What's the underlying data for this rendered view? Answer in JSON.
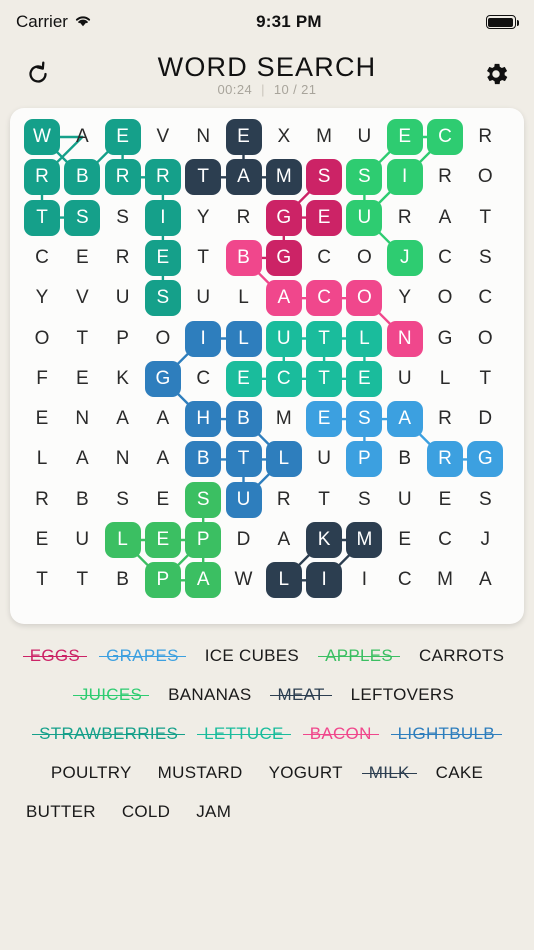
{
  "status_bar": {
    "carrier": "Carrier",
    "time": "9:31 PM",
    "wifi_icon": "wifi-icon",
    "battery_icon": "battery-full-icon"
  },
  "header": {
    "title": "WORD SEARCH",
    "timer": "00:24",
    "separator": "|",
    "progress": "10 / 21",
    "restart_icon": "restart-icon",
    "settings_icon": "gear-icon"
  },
  "grid": {
    "rows": 12,
    "cols": 12,
    "letters": [
      [
        "W",
        "A",
        "E",
        "V",
        "N",
        "E",
        "X",
        "M",
        "U",
        "E",
        "C",
        "R"
      ],
      [
        "R",
        "B",
        "R",
        "R",
        "T",
        "A",
        "M",
        "S",
        "S",
        "I",
        "R",
        "O"
      ],
      [
        "T",
        "S",
        "S",
        "I",
        "Y",
        "R",
        "G",
        "E",
        "U",
        "R",
        "A",
        "T"
      ],
      [
        "C",
        "E",
        "R",
        "E",
        "T",
        "B",
        "G",
        "C",
        "O",
        "J",
        "C",
        "S"
      ],
      [
        "Y",
        "V",
        "U",
        "S",
        "U",
        "L",
        "A",
        "C",
        "O",
        "Y",
        "O",
        "C"
      ],
      [
        "O",
        "T",
        "P",
        "O",
        "I",
        "L",
        "U",
        "T",
        "L",
        "N",
        "G",
        "O"
      ],
      [
        "F",
        "E",
        "K",
        "G",
        "C",
        "E",
        "C",
        "T",
        "E",
        "U",
        "L",
        "T"
      ],
      [
        "E",
        "N",
        "A",
        "A",
        "H",
        "B",
        "M",
        "E",
        "S",
        "A",
        "R",
        "D"
      ],
      [
        "L",
        "A",
        "N",
        "A",
        "B",
        "T",
        "L",
        "U",
        "P",
        "B",
        "R",
        "G"
      ],
      [
        "R",
        "B",
        "S",
        "E",
        "S",
        "U",
        "R",
        "T",
        "S",
        "U",
        "E",
        "S"
      ],
      [
        "E",
        "U",
        "L",
        "E",
        "P",
        "D",
        "A",
        "K",
        "M",
        "E",
        "C",
        "J"
      ],
      [
        "T",
        "T",
        "B",
        "P",
        "A",
        "W",
        "L",
        "I",
        "I",
        "C",
        "M",
        "A"
      ]
    ],
    "highlights": [
      {
        "word": "STRAWBERRIES",
        "color": "#15A08A",
        "path": [
          [
            0,
            0
          ],
          [
            1,
            1
          ],
          [
            0,
            2
          ],
          [
            1,
            3
          ],
          [
            2,
            0
          ],
          [
            1,
            2
          ],
          [
            1,
            0
          ],
          [
            2,
            1
          ],
          [
            3,
            3
          ],
          [
            4,
            3
          ],
          [
            2,
            3
          ]
        ]
      },
      {
        "word": "MEAT",
        "color": "#2C3E50",
        "path": [
          [
            0,
            5
          ],
          [
            1,
            5
          ],
          [
            1,
            4
          ],
          [
            1,
            6
          ]
        ]
      },
      {
        "word": "EGGS",
        "color": "#CC2366",
        "path": [
          [
            1,
            7
          ],
          [
            2,
            6
          ],
          [
            2,
            7
          ],
          [
            3,
            6
          ]
        ]
      },
      {
        "word": "JUICES",
        "color": "#2ECC71",
        "path": [
          [
            0,
            9
          ],
          [
            0,
            10
          ],
          [
            1,
            8
          ],
          [
            1,
            9
          ],
          [
            2,
            8
          ],
          [
            3,
            9
          ]
        ]
      },
      {
        "word": "BACON",
        "color": "#F0478C",
        "path": [
          [
            3,
            5
          ],
          [
            4,
            6
          ],
          [
            4,
            7
          ],
          [
            4,
            8
          ],
          [
            5,
            9
          ]
        ]
      },
      {
        "word": "LIGHTBULB",
        "color": "#2E7EBD",
        "path": [
          [
            5,
            4
          ],
          [
            5,
            5
          ],
          [
            6,
            3
          ],
          [
            7,
            4
          ],
          [
            7,
            5
          ],
          [
            8,
            5
          ],
          [
            8,
            6
          ],
          [
            8,
            4
          ],
          [
            9,
            5
          ]
        ]
      },
      {
        "word": "LETTUCE",
        "color": "#1ABC9C",
        "path": [
          [
            5,
            6
          ],
          [
            5,
            7
          ],
          [
            5,
            8
          ],
          [
            6,
            5
          ],
          [
            6,
            6
          ],
          [
            6,
            7
          ],
          [
            6,
            8
          ]
        ]
      },
      {
        "word": "GRAPES",
        "color": "#3CA0E0",
        "path": [
          [
            7,
            7
          ],
          [
            7,
            8
          ],
          [
            7,
            9
          ],
          [
            8,
            8
          ],
          [
            8,
            10
          ],
          [
            8,
            11
          ]
        ]
      },
      {
        "word": "APPLES",
        "color": "#3BBF62",
        "path": [
          [
            9,
            4
          ],
          [
            10,
            2
          ],
          [
            10,
            3
          ],
          [
            10,
            4
          ],
          [
            11,
            3
          ],
          [
            11,
            4
          ]
        ]
      },
      {
        "word": "MILK",
        "color": "#2C3E50",
        "path": [
          [
            10,
            7
          ],
          [
            10,
            8
          ],
          [
            11,
            6
          ],
          [
            11,
            7
          ]
        ]
      }
    ],
    "connections": [
      {
        "color": "#15A08A",
        "segs": [
          [
            [
              0,
              0
            ],
            [
              0,
              1
            ]
          ],
          [
            [
              0,
              1
            ],
            [
              1,
              0
            ]
          ],
          [
            [
              0,
              0
            ],
            [
              1,
              1
            ]
          ],
          [
            [
              1,
              0
            ],
            [
              2,
              0
            ]
          ],
          [
            [
              2,
              0
            ],
            [
              2,
              1
            ]
          ],
          [
            [
              1,
              1
            ],
            [
              0,
              2
            ]
          ],
          [
            [
              0,
              2
            ],
            [
              1,
              2
            ]
          ],
          [
            [
              1,
              2
            ],
            [
              1,
              3
            ]
          ],
          [
            [
              1,
              3
            ],
            [
              2,
              3
            ]
          ],
          [
            [
              2,
              3
            ],
            [
              3,
              3
            ]
          ],
          [
            [
              3,
              3
            ],
            [
              4,
              3
            ]
          ]
        ]
      },
      {
        "color": "#2C3E50",
        "segs": [
          [
            [
              0,
              5
            ],
            [
              1,
              5
            ]
          ],
          [
            [
              1,
              4
            ],
            [
              1,
              5
            ]
          ],
          [
            [
              1,
              5
            ],
            [
              1,
              6
            ]
          ]
        ]
      },
      {
        "color": "#CC2366",
        "segs": [
          [
            [
              1,
              7
            ],
            [
              2,
              6
            ]
          ],
          [
            [
              2,
              6
            ],
            [
              2,
              7
            ]
          ],
          [
            [
              2,
              6
            ],
            [
              3,
              6
            ]
          ],
          [
            [
              3,
              5
            ],
            [
              3,
              6
            ]
          ]
        ]
      },
      {
        "color": "#2ECC71",
        "segs": [
          [
            [
              0,
              9
            ],
            [
              0,
              10
            ]
          ],
          [
            [
              0,
              9
            ],
            [
              1,
              8
            ]
          ],
          [
            [
              0,
              10
            ],
            [
              1,
              9
            ]
          ],
          [
            [
              1,
              9
            ],
            [
              2,
              8
            ]
          ],
          [
            [
              1,
              8
            ],
            [
              2,
              8
            ]
          ],
          [
            [
              2,
              8
            ],
            [
              3,
              9
            ]
          ]
        ]
      },
      {
        "color": "#F0478C",
        "segs": [
          [
            [
              3,
              5
            ],
            [
              4,
              6
            ]
          ],
          [
            [
              4,
              6
            ],
            [
              4,
              7
            ]
          ],
          [
            [
              4,
              7
            ],
            [
              4,
              8
            ]
          ],
          [
            [
              4,
              8
            ],
            [
              5,
              9
            ]
          ]
        ]
      },
      {
        "color": "#2E7EBD",
        "segs": [
          [
            [
              5,
              4
            ],
            [
              5,
              5
            ]
          ],
          [
            [
              5,
              4
            ],
            [
              6,
              3
            ]
          ],
          [
            [
              6,
              3
            ],
            [
              7,
              4
            ]
          ],
          [
            [
              7,
              4
            ],
            [
              7,
              5
            ]
          ],
          [
            [
              7,
              5
            ],
            [
              8,
              6
            ]
          ],
          [
            [
              8,
              4
            ],
            [
              8,
              5
            ]
          ],
          [
            [
              8,
              5
            ],
            [
              8,
              6
            ]
          ],
          [
            [
              8,
              5
            ],
            [
              9,
              5
            ]
          ],
          [
            [
              8,
              6
            ],
            [
              9,
              5
            ]
          ]
        ]
      },
      {
        "color": "#1ABC9C",
        "segs": [
          [
            [
              5,
              6
            ],
            [
              5,
              7
            ]
          ],
          [
            [
              5,
              7
            ],
            [
              5,
              8
            ]
          ],
          [
            [
              5,
              6
            ],
            [
              6,
              6
            ]
          ],
          [
            [
              5,
              7
            ],
            [
              6,
              7
            ]
          ],
          [
            [
              5,
              8
            ],
            [
              6,
              8
            ]
          ],
          [
            [
              6,
              5
            ],
            [
              6,
              6
            ]
          ],
          [
            [
              6,
              6
            ],
            [
              6,
              7
            ]
          ],
          [
            [
              6,
              7
            ],
            [
              6,
              8
            ]
          ]
        ]
      },
      {
        "color": "#3CA0E0",
        "segs": [
          [
            [
              7,
              7
            ],
            [
              7,
              8
            ]
          ],
          [
            [
              7,
              8
            ],
            [
              8,
              8
            ]
          ],
          [
            [
              7,
              8
            ],
            [
              7,
              9
            ]
          ],
          [
            [
              7,
              9
            ],
            [
              8,
              10
            ]
          ],
          [
            [
              8,
              10
            ],
            [
              8,
              11
            ]
          ]
        ]
      },
      {
        "color": "#3BBF62",
        "segs": [
          [
            [
              9,
              4
            ],
            [
              10,
              4
            ]
          ],
          [
            [
              10,
              2
            ],
            [
              10,
              3
            ]
          ],
          [
            [
              10,
              3
            ],
            [
              10,
              4
            ]
          ],
          [
            [
              10,
              2
            ],
            [
              11,
              3
            ]
          ],
          [
            [
              11,
              3
            ],
            [
              10,
              4
            ]
          ],
          [
            [
              10,
              4
            ],
            [
              11,
              4
            ]
          ],
          [
            [
              11,
              3
            ],
            [
              11,
              4
            ]
          ]
        ]
      },
      {
        "color": "#2C3E50",
        "segs": [
          [
            [
              10,
              7
            ],
            [
              10,
              8
            ]
          ],
          [
            [
              11,
              6
            ],
            [
              10,
              7
            ]
          ],
          [
            [
              11,
              6
            ],
            [
              11,
              7
            ]
          ],
          [
            [
              11,
              7
            ],
            [
              10,
              8
            ]
          ]
        ]
      }
    ]
  },
  "word_list": {
    "rows": [
      [
        {
          "label": "EGGS",
          "found": true,
          "color": "#CC2366"
        },
        {
          "label": "GRAPES",
          "found": true,
          "color": "#3CA0E0"
        },
        {
          "label": "ICE CUBES",
          "found": false,
          "color": "#1A1A1A"
        },
        {
          "label": "APPLES",
          "found": true,
          "color": "#3BBF62"
        },
        {
          "label": "CARROTS",
          "found": false,
          "color": "#1A1A1A"
        }
      ],
      [
        {
          "label": "JUICES",
          "found": true,
          "color": "#2ECC71"
        },
        {
          "label": "BANANAS",
          "found": false,
          "color": "#1A1A1A"
        },
        {
          "label": "MEAT",
          "found": true,
          "color": "#2C3E50"
        },
        {
          "label": "LEFTOVERS",
          "found": false,
          "color": "#1A1A1A"
        }
      ],
      [
        {
          "label": "STRAWBERRIES",
          "found": true,
          "color": "#15A08A"
        },
        {
          "label": "LETTUCE",
          "found": true,
          "color": "#1ABC9C"
        },
        {
          "label": "BACON",
          "found": true,
          "color": "#F0478C"
        },
        {
          "label": "LIGHTBULB",
          "found": true,
          "color": "#2E7EBD"
        }
      ],
      [
        {
          "label": "POULTRY",
          "found": false,
          "color": "#1A1A1A"
        },
        {
          "label": "MUSTARD",
          "found": false,
          "color": "#1A1A1A"
        },
        {
          "label": "YOGURT",
          "found": false,
          "color": "#1A1A1A"
        },
        {
          "label": "MILK",
          "found": true,
          "color": "#2C3E50"
        },
        {
          "label": "CAKE",
          "found": false,
          "color": "#1A1A1A"
        }
      ],
      [
        {
          "label": "BUTTER",
          "found": false,
          "color": "#1A1A1A"
        },
        {
          "label": "COLD",
          "found": false,
          "color": "#1A1A1A"
        },
        {
          "label": "JAM",
          "found": false,
          "color": "#1A1A1A"
        }
      ]
    ]
  }
}
